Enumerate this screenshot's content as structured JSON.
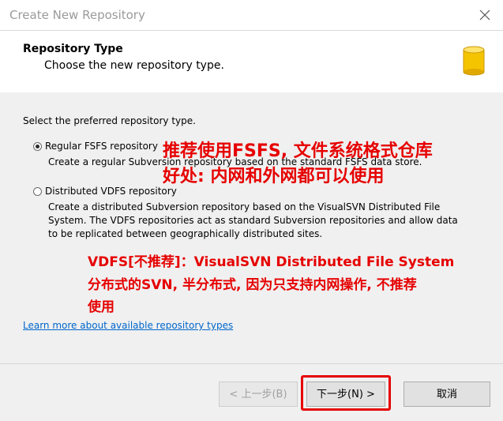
{
  "window": {
    "title": "Create New Repository"
  },
  "header": {
    "title": "Repository Type",
    "subtitle": "Choose the new repository type."
  },
  "content": {
    "prompt": "Select the preferred repository type.",
    "options": [
      {
        "label": "Regular FSFS repository",
        "selected": true,
        "description": "Create a regular Subversion repository based on the standard FSFS data store."
      },
      {
        "label": "Distributed VDFS repository",
        "selected": false,
        "description": "Create a distributed Subversion repository based on the VisualSVN Distributed File System. The VDFS repositories act as standard Subversion repositories and allow data to be replicated between geographically distributed sites."
      }
    ],
    "link": "Learn more about available repository types"
  },
  "annotations": {
    "fsfs_line1": "推荐使用FSFS, 文件系统格式仓库",
    "fsfs_line2": "好处: 内网和外网都可以使用",
    "vdfs_line1": "VDFS[不推荐]：VisualSVN  Distributed File System",
    "vdfs_line2": "分布式的SVN, 半分布式, 因为只支持内网操作, 不推荐",
    "vdfs_line3": "使用"
  },
  "footer": {
    "back_label": "< 上一步(B)",
    "next_label": "下一步(N) >",
    "cancel_label": "取消"
  },
  "colors": {
    "annotation": "#e60000",
    "link": "#0066cc",
    "dialog_body": "#f0f0f0",
    "db_icon": "#f5c400"
  },
  "icons": [
    "close-icon",
    "database-icon"
  ]
}
